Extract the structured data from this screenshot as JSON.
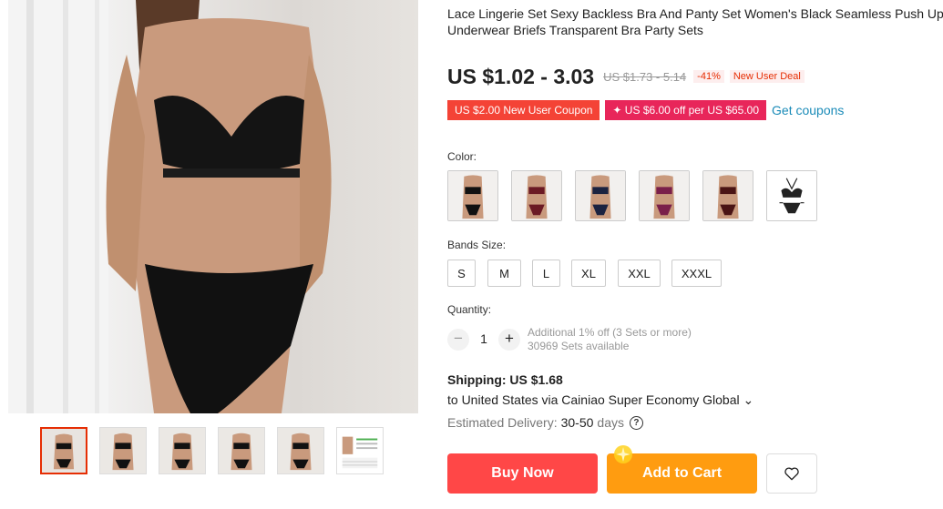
{
  "product": {
    "title": "Lace Lingerie Set Sexy Backless Bra And Panty Set Women's Black Seamless Push Up Underwear Briefs Transparent Bra Party Sets",
    "price": "US $1.02 - 3.03",
    "old_price": "US $1.73 - 5.14",
    "discount": "-41%",
    "deal_tag": "New User Deal"
  },
  "coupons": {
    "new_user": "US $2.00 New User Coupon",
    "store": "✦ US $6.00 off per US $65.00",
    "get_link": "Get coupons"
  },
  "color": {
    "label": "Color:",
    "options": [
      "black",
      "red-wine",
      "navy",
      "rose",
      "burgundy",
      "size-chart-line"
    ]
  },
  "size": {
    "label": "Bands Size:",
    "options": [
      "S",
      "M",
      "L",
      "XL",
      "XXL",
      "XXXL"
    ]
  },
  "quantity": {
    "label": "Quantity:",
    "minus": "−",
    "value": "1",
    "plus": "+",
    "note_line1": "Additional 1% off (3 Sets or more)",
    "note_line2": "30969 Sets available"
  },
  "shipping": {
    "title": "Shipping: US $1.68",
    "route": "to United States via Cainiao Super Economy Global ⌄",
    "delivery_label": "Estimated Delivery:",
    "delivery_days": "30-50",
    "delivery_unit": "days",
    "help": "?"
  },
  "actions": {
    "buy": "Buy Now",
    "cart": "Add to Cart"
  },
  "colors": {
    "accent_red": "#ff4747",
    "accent_orange": "#ff9c10",
    "link": "#1a8bb8"
  }
}
